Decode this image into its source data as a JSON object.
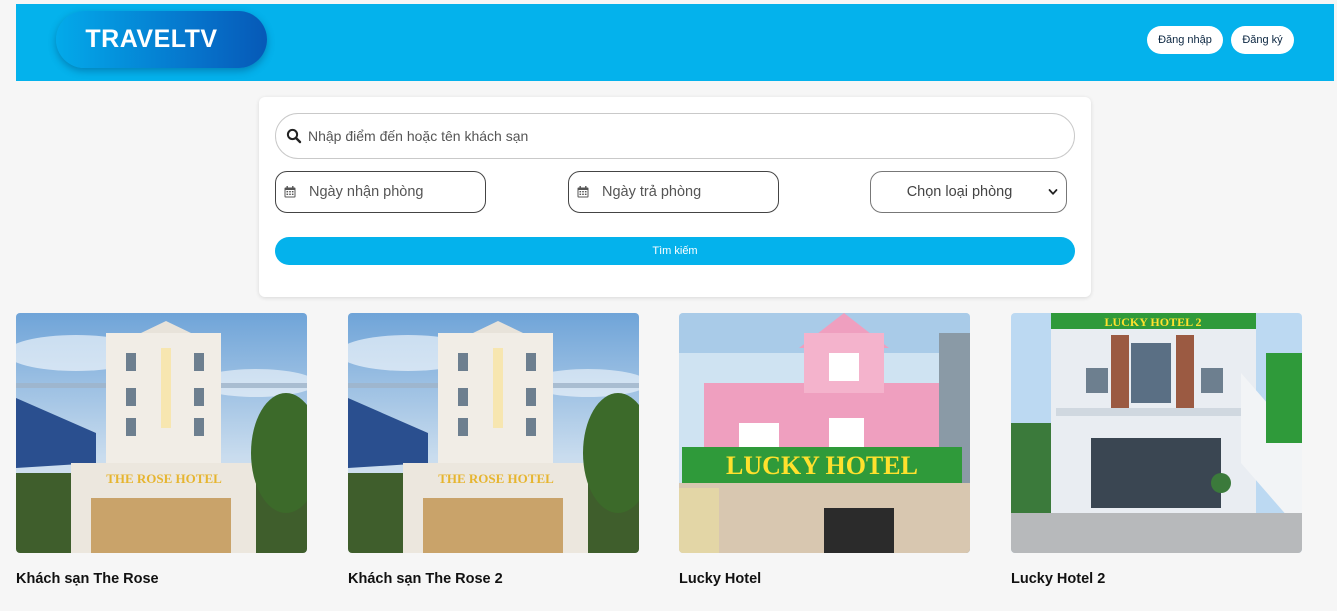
{
  "header": {
    "logo_text": "TRAVELTV",
    "login_label": "Đăng nhập",
    "register_label": "Đăng ký",
    "bg_color": "#04b2ec"
  },
  "search": {
    "query_placeholder": "Nhập điểm đến hoặc tên khách sạn",
    "checkin_placeholder": "Ngày nhận phòng",
    "checkout_placeholder": "Ngày trả phòng",
    "room_type_value": "Chọn loại phòng",
    "submit_label": "Tìm kiếm",
    "icons": [
      "search-icon",
      "calendar-icon",
      "calendar-icon",
      "chevron-down-icon"
    ]
  },
  "hotels": [
    {
      "name": "Khách sạn The Rose",
      "sign": "THE ROSE HOTEL"
    },
    {
      "name": "Khách sạn The Rose 2",
      "sign": "THE ROSE HOTEL"
    },
    {
      "name": "Lucky Hotel",
      "sign": "LUCKY HOTEL"
    },
    {
      "name": "Lucky Hotel 2",
      "sign": "LUCKY HOTEL 2"
    }
  ]
}
